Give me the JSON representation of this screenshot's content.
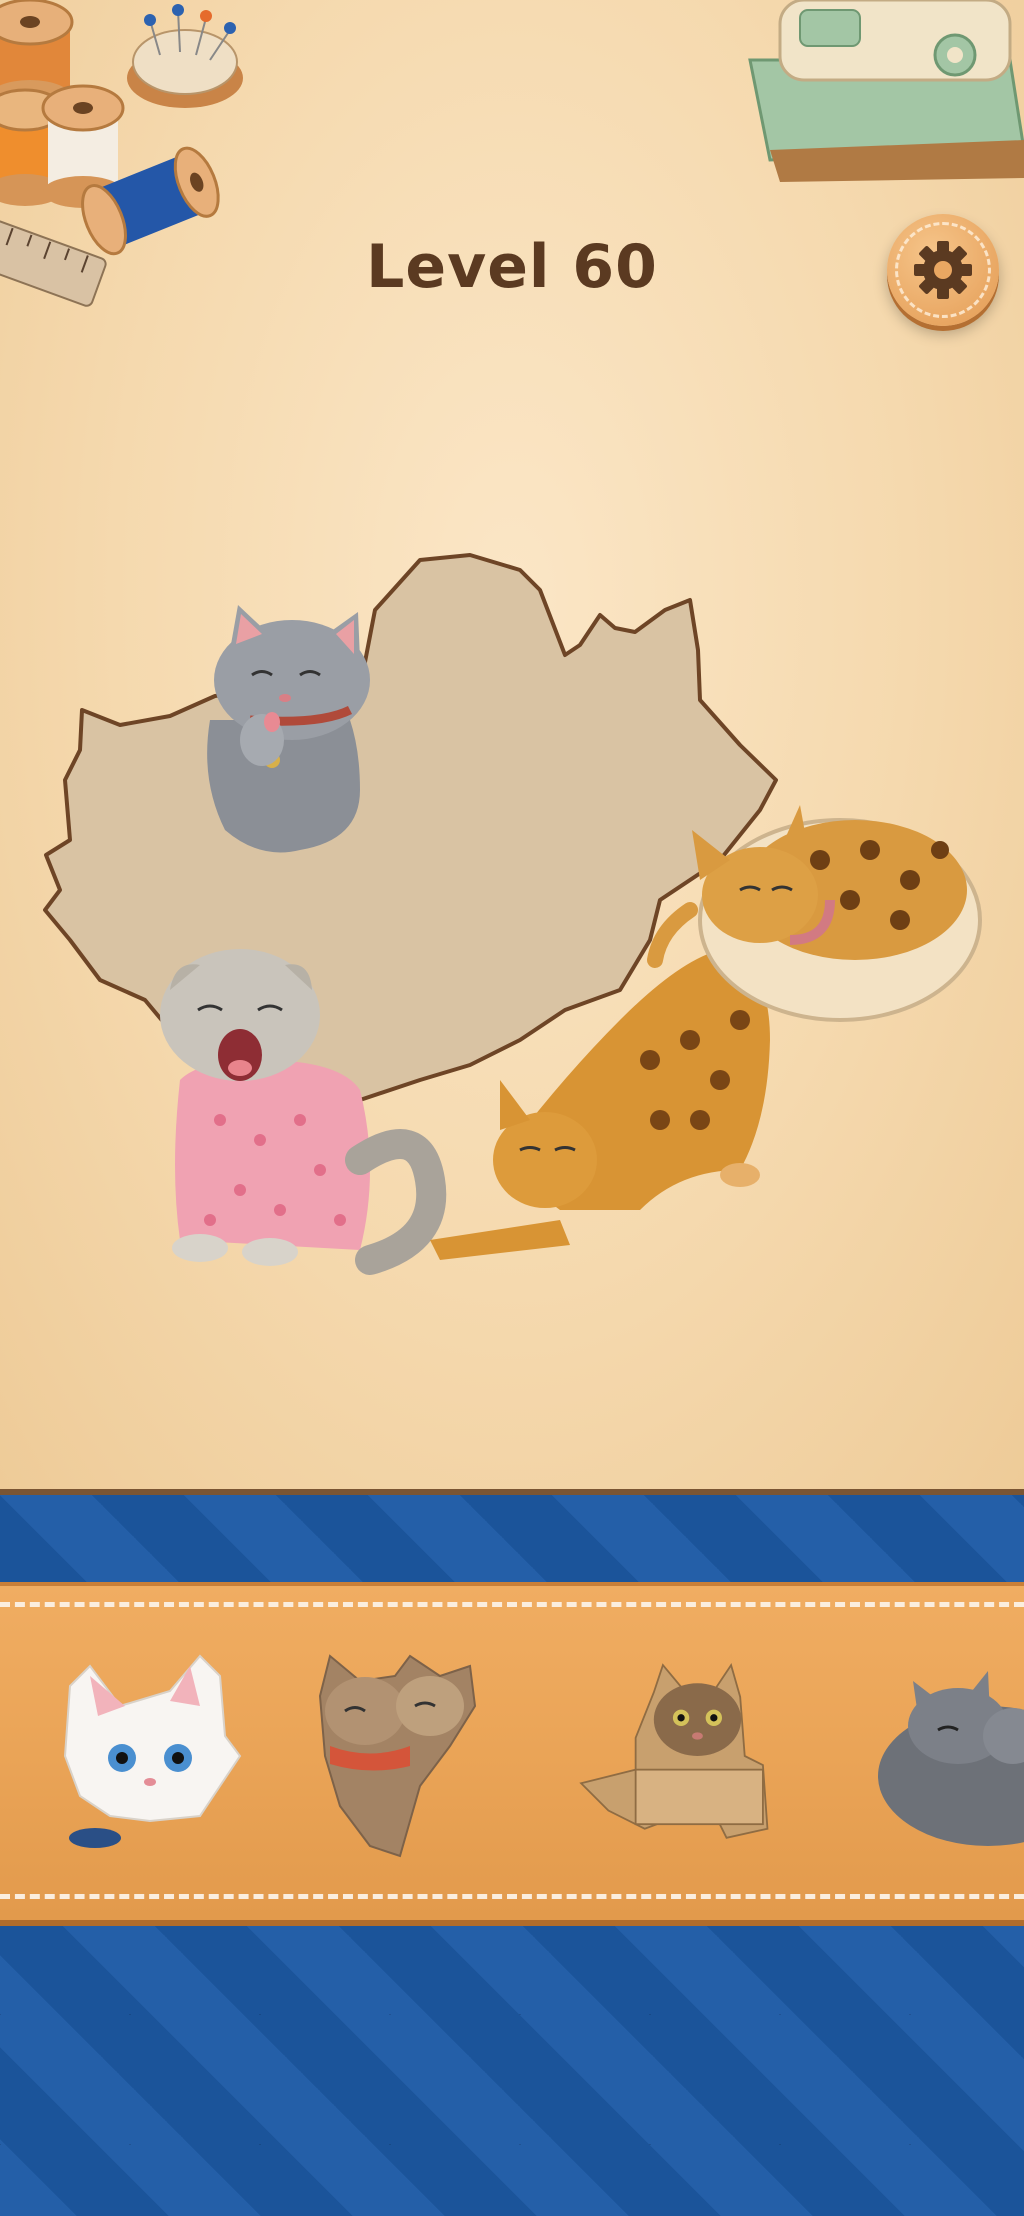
{
  "header": {
    "level_text": "Level 60",
    "settings_icon": "gear-icon"
  },
  "decorations": [
    "thread-spools-icon",
    "pincushion-icon",
    "measuring-tape-icon",
    "sewing-machine-icon"
  ],
  "puzzle": {
    "placed_pieces": [
      {
        "name": "gray-cat-licking-paw"
      },
      {
        "name": "scottish-fold-cat-pink-pajamas-yawning"
      },
      {
        "name": "bengal-cat-stretching"
      },
      {
        "name": "bengal-cat-sleeping-in-bed"
      }
    ],
    "empty_slot": "puzzle-silhouette"
  },
  "tray": {
    "pieces": [
      {
        "name": "white-cat-piece"
      },
      {
        "name": "two-tabby-cats-hugging-piece"
      },
      {
        "name": "tabby-cat-in-box-piece"
      },
      {
        "name": "gray-cats-sleeping-piece"
      }
    ]
  },
  "colors": {
    "board_bg": "#f6dcb2",
    "title": "#5b3a21",
    "silhouette": "#d9c3a3",
    "quilt": "#1d5aa0",
    "tray": "#eaa457"
  }
}
